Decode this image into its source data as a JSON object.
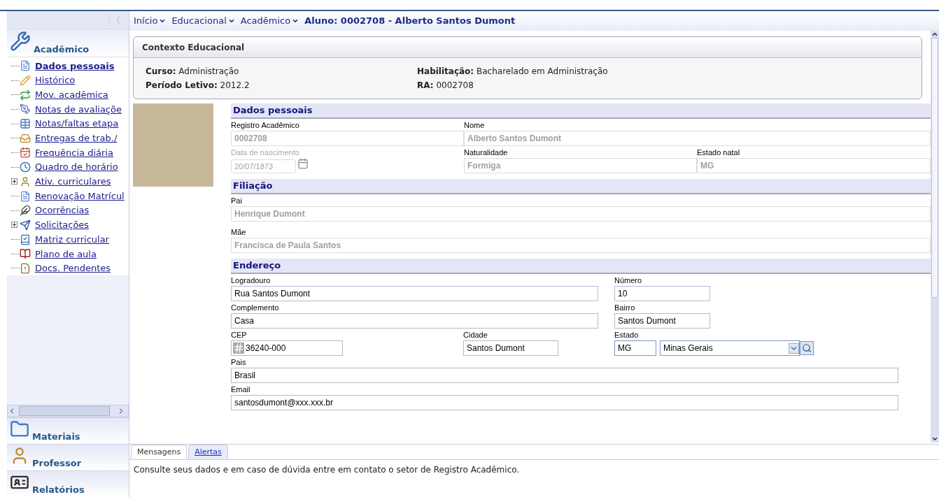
{
  "sidebar": {
    "collapse_label": "《",
    "active_module": {
      "title": "Acadêmico",
      "items": [
        {
          "label": "Dados pessoais",
          "selected": true,
          "expandable": false
        },
        {
          "label": "Histórico",
          "selected": false,
          "expandable": false
        },
        {
          "label": "Mov. acadêmica",
          "selected": false,
          "expandable": false
        },
        {
          "label": "Notas de avaliaçõe",
          "selected": false,
          "expandable": false
        },
        {
          "label": "Notas/faltas etapa",
          "selected": false,
          "expandable": false
        },
        {
          "label": "Entregas de trab./",
          "selected": false,
          "expandable": false
        },
        {
          "label": "Frequência diária",
          "selected": false,
          "expandable": false
        },
        {
          "label": "Quadro de horário",
          "selected": false,
          "expandable": false
        },
        {
          "label": "Ativ. curriculares",
          "selected": false,
          "expandable": true
        },
        {
          "label": "Renovação Matrícul",
          "selected": false,
          "expandable": false
        },
        {
          "label": "Ocorrências",
          "selected": false,
          "expandable": false
        },
        {
          "label": "Solicitações",
          "selected": false,
          "expandable": true
        },
        {
          "label": "Matriz curricular",
          "selected": false,
          "expandable": false
        },
        {
          "label": "Plano de aula",
          "selected": false,
          "expandable": false
        },
        {
          "label": "Docs. Pendentes",
          "selected": false,
          "expandable": false
        }
      ]
    },
    "modules": [
      {
        "title": "Materiais"
      },
      {
        "title": "Professor"
      },
      {
        "title": "Relatórios"
      }
    ]
  },
  "breadcrumb": {
    "links": [
      "Início",
      "Educacional",
      "Acadêmico"
    ],
    "current": "Aluno: 0002708 - Alberto Santos Dumont"
  },
  "context": {
    "title": "Contexto Educacional",
    "fields": [
      {
        "label": "Curso:",
        "value": "Administração"
      },
      {
        "label": "Habilitação:",
        "value": "Bacharelado em Administração"
      },
      {
        "label": "Período Letivo:",
        "value": "2012.2"
      },
      {
        "label": "RA:",
        "value": "0002708"
      }
    ]
  },
  "sections": [
    {
      "title": "Dados pessoais",
      "rows": [
        [
          {
            "label": "Registro Acadêmico",
            "value": "0002708",
            "kind": "text",
            "disabled": true
          },
          {
            "label": "Nome",
            "value": "Alberto Santos Dumont",
            "kind": "text",
            "disabled": true
          }
        ],
        [
          {
            "label": "Data de nascimento",
            "value": "20/07/1873",
            "kind": "date",
            "disabled": true
          },
          {
            "label": "Naturalidade",
            "value": "Formiga",
            "kind": "text",
            "disabled": true
          },
          {
            "label": "Estado natal",
            "value": "MG",
            "kind": "text",
            "disabled": true
          }
        ]
      ]
    },
    {
      "title": "Filiação",
      "rows": [
        [
          {
            "label": "Pai",
            "value": "Henrique Dumont",
            "kind": "text",
            "disabled": true
          }
        ],
        [
          {
            "label": "Mãe",
            "value": "Francisca de Paula Santos",
            "kind": "text",
            "disabled": true
          }
        ]
      ]
    },
    {
      "title": "Endereço",
      "rows": [
        [
          {
            "label": "Logradouro",
            "value": "Rua Santos Dumont",
            "kind": "text",
            "disabled": false
          },
          {
            "label": "Número",
            "value": "10",
            "kind": "text",
            "disabled": false
          }
        ],
        [
          {
            "label": "Complemento",
            "value": "Casa",
            "kind": "text",
            "disabled": false
          },
          {
            "label": "Bairro",
            "value": "Santos Dumont",
            "kind": "text",
            "disabled": false
          }
        ],
        [
          {
            "label": "CEP",
            "value": "36240-000",
            "kind": "cep",
            "disabled": false
          },
          {
            "label": "Cidade",
            "value": "Santos Dumont",
            "kind": "text",
            "disabled": false
          },
          {
            "label": "Estado",
            "value": "MG",
            "option": "Minas Gerais",
            "kind": "select",
            "disabled": false
          }
        ],
        [
          {
            "label": "Pais",
            "value": "Brasil",
            "kind": "text",
            "disabled": false
          }
        ],
        [
          {
            "label": "Email",
            "value": "santosdumont@xxx.xxx.br",
            "kind": "text",
            "disabled": false
          }
        ]
      ]
    }
  ],
  "bottom_panel": {
    "tabs": [
      {
        "label": "Mensagens",
        "selected": true
      },
      {
        "label": "Alertas",
        "selected": false
      }
    ],
    "message": "Consulte seus dados e em caso de dúvida entre em contato o setor de Registro Acadêmico."
  }
}
